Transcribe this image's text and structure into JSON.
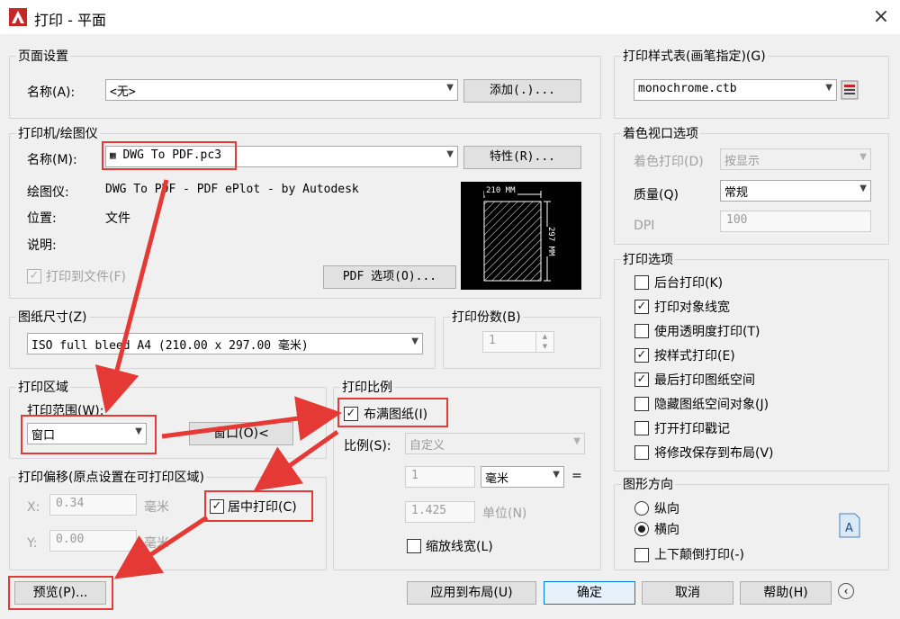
{
  "window": {
    "title": "打印 - 平面",
    "close": "×"
  },
  "page_setup": {
    "group_label": "页面设置",
    "name_label": "名称(A):",
    "name_value": "<无>",
    "add_button": "添加(.)..."
  },
  "printer": {
    "group_label": "打印机/绘图仪",
    "name_label": "名称(M):",
    "name_value": "DWG To PDF.pc3",
    "properties_button": "特性(R)...",
    "plotter_label": "绘图仪:",
    "plotter_value": "DWG To PDF - PDF ePlot - by Autodesk",
    "location_label": "位置:",
    "location_value": "文件",
    "description_label": "说明:",
    "print_to_file": "打印到文件(F)",
    "pdf_options_button": "PDF 选项(O)...",
    "preview_width": "210 MM",
    "preview_height": "297 MM"
  },
  "paper_size": {
    "group_label": "图纸尺寸(Z)",
    "value": "ISO full bleed A4 (210.00 x 297.00 毫米)"
  },
  "copies": {
    "group_label": "打印份数(B)",
    "value": "1"
  },
  "plot_area": {
    "group_label": "打印区域",
    "range_label": "打印范围(W):",
    "range_value": "窗口",
    "window_button": "窗口(O)<"
  },
  "plot_offset": {
    "group_label": "打印偏移(原点设置在可打印区域)",
    "x_label": "X:",
    "x_value": "0.34",
    "y_label": "Y:",
    "y_value": "0.00",
    "unit": "毫米",
    "center_label": "居中打印(C)"
  },
  "plot_scale": {
    "group_label": "打印比例",
    "fit_label": "布满图纸(I)",
    "scale_label": "比例(S):",
    "scale_value": "自定义",
    "value1": "1",
    "unit_value": "毫米",
    "equals": "=",
    "value2": "1.425",
    "unit2": "单位(N)",
    "lineweights_label": "缩放线宽(L)"
  },
  "plot_style": {
    "group_label": "打印样式表(画笔指定)(G)",
    "value": "monochrome.ctb"
  },
  "shaded": {
    "group_label": "着色视口选项",
    "shade_label": "着色打印(D)",
    "shade_value": "按显示",
    "quality_label": "质量(Q)",
    "quality_value": "常规",
    "dpi_label": "DPI",
    "dpi_value": "100"
  },
  "options": {
    "group_label": "打印选项",
    "items": [
      {
        "label": "后台打印(K)",
        "checked": false
      },
      {
        "label": "打印对象线宽",
        "checked": true
      },
      {
        "label": "使用透明度打印(T)",
        "checked": false
      },
      {
        "label": "按样式打印(E)",
        "checked": true
      },
      {
        "label": "最后打印图纸空间",
        "checked": true
      },
      {
        "label": "隐藏图纸空间对象(J)",
        "checked": false
      },
      {
        "label": "打开打印戳记",
        "checked": false
      },
      {
        "label": "将修改保存到布局(V)",
        "checked": false
      }
    ]
  },
  "orientation": {
    "group_label": "图形方向",
    "portrait": "纵向",
    "landscape": "横向",
    "upside_down": "上下颠倒打印(-)"
  },
  "footer": {
    "preview_button": "预览(P)...",
    "apply_button": "应用到布局(U)",
    "ok_button": "确定",
    "cancel_button": "取消",
    "help_button": "帮助(H)"
  },
  "colors": {
    "highlight": "#e53935",
    "accent": "#c62828"
  }
}
